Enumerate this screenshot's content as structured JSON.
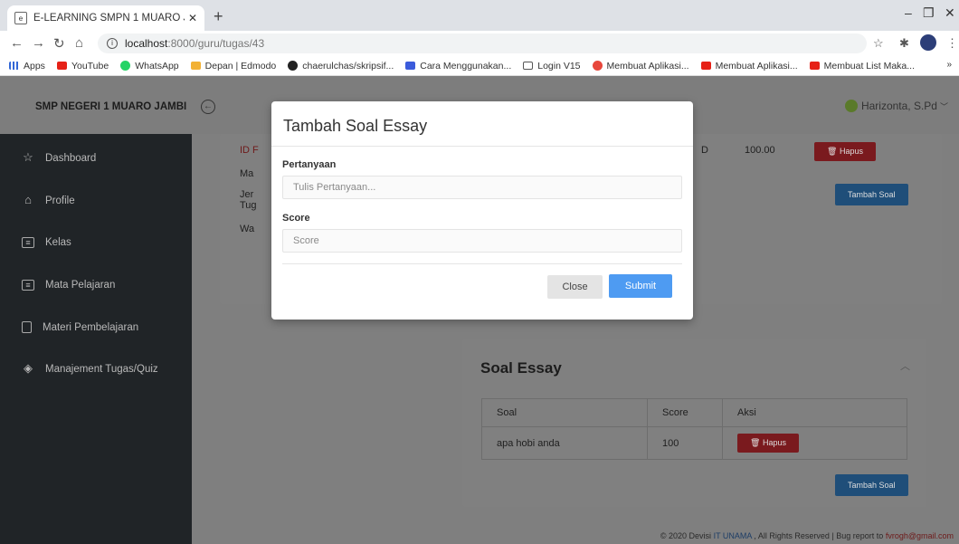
{
  "browser": {
    "tab_title": "E-LEARNING SMPN 1 MUARO JA",
    "new_tab": "+",
    "url_host": "localhost",
    "url_path": ":8000/guru/tugas/43",
    "bookmarks": [
      {
        "label": "Apps",
        "icon": "apps-icon"
      },
      {
        "label": "YouTube",
        "icon": "youtube-icon"
      },
      {
        "label": "WhatsApp",
        "icon": "whatsapp-icon"
      },
      {
        "label": "Depan | Edmodo",
        "icon": "edmodo-icon"
      },
      {
        "label": "chaerulchas/skripsif...",
        "icon": "github-icon"
      },
      {
        "label": "Cara Menggunakan...",
        "icon": "cara-icon"
      },
      {
        "label": "Login V15",
        "icon": "login-icon"
      },
      {
        "label": "Membuat Aplikasi...",
        "icon": "membuat-icon"
      },
      {
        "label": "Membuat Aplikasi...",
        "icon": "youtube-icon"
      },
      {
        "label": "Membuat List Maka...",
        "icon": "youtube-icon"
      }
    ],
    "more": "»"
  },
  "app": {
    "brand": "SMP NEGERI 1 MUARO JAMBI",
    "user": "Harizonta, S.Pd",
    "sidebar": [
      {
        "label": "Dashboard",
        "icon": "star-icon"
      },
      {
        "label": "Profile",
        "icon": "home-icon"
      },
      {
        "label": "Kelas",
        "icon": "database-icon"
      },
      {
        "label": "Mata Pelajaran",
        "icon": "database-icon"
      },
      {
        "label": "Materi Pembelajaran",
        "icon": "tablet-icon"
      },
      {
        "label": "Manajement Tugas/Quiz",
        "icon": "layers-icon"
      }
    ],
    "top_card": {
      "fragments": [
        "ID F",
        "Ma",
        "Jer",
        "Tug",
        "Wa",
        "D"
      ],
      "score": "100.00",
      "hapus": "Hapus",
      "tambah": "Tambah Soal"
    },
    "essay_card": {
      "title": "Soal Essay",
      "headers": [
        "Soal",
        "Score",
        "Aksi"
      ],
      "rows": [
        {
          "soal": "apa hobi anda",
          "score": "100",
          "aksi": "Hapus"
        }
      ],
      "tambah": "Tambah Soal"
    },
    "footer": {
      "prefix": "© 2020 Devisi ",
      "org": "IT UNAMA",
      "middle": " , All Rights Reserved | Bug report to ",
      "email": "fvrogh@gmail.com"
    }
  },
  "modal": {
    "title": "Tambah Soal Essay",
    "question_label": "Pertanyaan",
    "question_placeholder": "Tulis Pertanyaan...",
    "score_label": "Score",
    "score_placeholder": "Score",
    "close_label": "Close",
    "submit_label": "Submit"
  }
}
